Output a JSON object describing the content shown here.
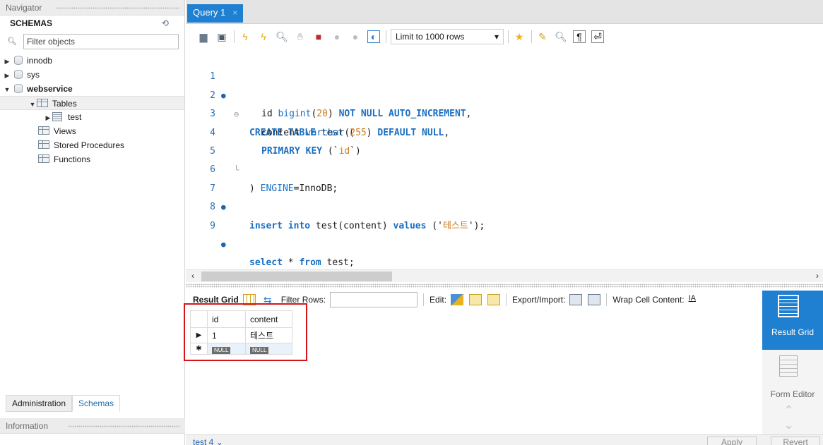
{
  "navigator": {
    "title": "Navigator",
    "schemas_label": "SCHEMAS",
    "filter_placeholder": "Filter objects",
    "tree": {
      "innodb": "innodb",
      "sys": "sys",
      "webservice": "webservice",
      "tables": "Tables",
      "test": "test",
      "views": "Views",
      "stored_procedures": "Stored Procedures",
      "functions": "Functions"
    },
    "tabs": {
      "administration": "Administration",
      "schemas": "Schemas"
    },
    "information": "Information"
  },
  "editor_tab": {
    "title": "Query 1",
    "close": "×"
  },
  "toolbar": {
    "limit": "Limit to 1000 rows"
  },
  "sql": {
    "l1_kw": "CREATE TABLE",
    "l1_rest": " test (",
    "l2_a": "id ",
    "l2_type": "bigint",
    "l2_b": "(",
    "l2_num": "20",
    "l2_c": ") ",
    "l2_kw": "NOT NULL AUTO_INCREMENT",
    "l2_d": ",",
    "l3_a": "content ",
    "l3_type": "varchar",
    "l3_b": "(",
    "l3_num": "255",
    "l3_c": ") ",
    "l3_kw": "DEFAULT NULL",
    "l3_d": ",",
    "l4_kw": "PRIMARY KEY",
    "l4_a": " (`",
    "l4_str": "id",
    "l4_b": "`)",
    "l5_a": ") ",
    "l5_kw": "ENGINE",
    "l5_b": "=InnoDB;",
    "l7_kw1": "insert into",
    "l7_a": " test(content) ",
    "l7_kw2": "values",
    "l7_b": " ('",
    "l7_str": "테스트",
    "l7_c": "');",
    "l9_kw1": "select",
    "l9_a": " * ",
    "l9_kw2": "from",
    "l9_b": " test;"
  },
  "line_numbers": [
    "1",
    "2",
    "3",
    "4",
    "5",
    "6",
    "7",
    "8",
    "9"
  ],
  "result_toolbar": {
    "result_grid": "Result Grid",
    "filter_rows": "Filter Rows:",
    "edit": "Edit:",
    "export_import": "Export/Import:",
    "wrap_cell": "Wrap Cell Content:"
  },
  "result_grid": {
    "columns": [
      "id",
      "content"
    ],
    "rows": [
      [
        "1",
        "테스트"
      ]
    ],
    "null_label": "NULL"
  },
  "side_buttons": {
    "result_grid": "Result Grid",
    "form_editor": "Form Editor"
  },
  "bottom": {
    "result_tab": "test 4",
    "apply": "Apply",
    "revert": "Revert"
  },
  "colors": {
    "accent": "#1f7fd0",
    "keyword": "#1a6fc2",
    "literal": "#d07a1b",
    "highlight_box": "#d4161a"
  }
}
